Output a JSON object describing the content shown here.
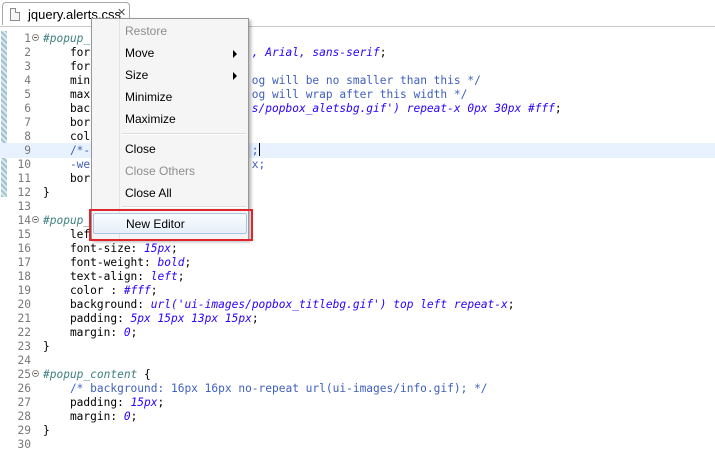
{
  "tab": {
    "filename": "jquery.alerts.css",
    "close_glyph": "✕"
  },
  "editor": {
    "current_line": 9,
    "lines": [
      {
        "n": "1",
        "fold": true,
        "parts": [
          [
            "c-sel",
            "#popup_"
          ]
        ]
      },
      {
        "n": "2",
        "fold": false,
        "parts": [
          [
            "c-prop",
            "    for"
          ],
          [
            "c-val",
            "                        , Arial, sans-serif"
          ],
          [
            "c-plain",
            ";"
          ]
        ]
      },
      {
        "n": "3",
        "fold": false,
        "parts": [
          [
            "c-prop",
            "    for"
          ]
        ]
      },
      {
        "n": "4",
        "fold": false,
        "parts": [
          [
            "c-prop",
            "    min"
          ],
          [
            "c-com",
            "                        og will be no smaller than this */"
          ]
        ]
      },
      {
        "n": "5",
        "fold": false,
        "parts": [
          [
            "c-prop",
            "    max"
          ],
          [
            "c-com",
            "                        og will wrap after this width */"
          ]
        ]
      },
      {
        "n": "6",
        "fold": false,
        "parts": [
          [
            "c-prop",
            "    bac"
          ],
          [
            "c-val",
            "                        s/popbox_aletsbg.gif') repeat-x 0px 30px #fff"
          ],
          [
            "c-plain",
            ";"
          ]
        ]
      },
      {
        "n": "7",
        "fold": false,
        "parts": [
          [
            "c-prop",
            "    bor"
          ]
        ]
      },
      {
        "n": "8",
        "fold": false,
        "parts": [
          [
            "c-prop",
            "    col"
          ]
        ]
      },
      {
        "n": "9",
        "fold": false,
        "parts": [
          [
            "c-com",
            "    /*-"
          ],
          [
            "c-com",
            "                        ;"
          ]
        ],
        "cursor": true
      },
      {
        "n": "10",
        "fold": false,
        "parts": [
          [
            "c-com",
            "    -we"
          ],
          [
            "c-com",
            "                        x;"
          ]
        ]
      },
      {
        "n": "11",
        "fold": false,
        "parts": [
          [
            "c-prop",
            "    bor"
          ]
        ]
      },
      {
        "n": "12",
        "fold": false,
        "parts": [
          [
            "c-plain",
            "}"
          ]
        ]
      },
      {
        "n": "13",
        "fold": false,
        "parts": []
      },
      {
        "n": "14",
        "fold": true,
        "parts": [
          [
            "c-sel",
            "#popup_"
          ]
        ]
      },
      {
        "n": "15",
        "fold": false,
        "parts": [
          [
            "c-prop",
            "    lef"
          ]
        ]
      },
      {
        "n": "16",
        "fold": false,
        "parts": [
          [
            "c-prop",
            "    font-size: "
          ],
          [
            "c-val",
            "15px"
          ],
          [
            "c-plain",
            ";"
          ]
        ]
      },
      {
        "n": "17",
        "fold": false,
        "parts": [
          [
            "c-prop",
            "    font-weight: "
          ],
          [
            "c-val",
            "bold"
          ],
          [
            "c-plain",
            ";"
          ]
        ]
      },
      {
        "n": "18",
        "fold": false,
        "parts": [
          [
            "c-prop",
            "    text-align: "
          ],
          [
            "c-val",
            "left"
          ],
          [
            "c-plain",
            ";"
          ]
        ]
      },
      {
        "n": "19",
        "fold": false,
        "parts": [
          [
            "c-prop",
            "    color : "
          ],
          [
            "c-val",
            "#fff"
          ],
          [
            "c-plain",
            ";"
          ]
        ]
      },
      {
        "n": "20",
        "fold": false,
        "parts": [
          [
            "c-prop",
            "    background: "
          ],
          [
            "c-val",
            "url('ui-images/popbox_titlebg.gif') top left repeat-x"
          ],
          [
            "c-plain",
            ";"
          ]
        ]
      },
      {
        "n": "21",
        "fold": false,
        "parts": [
          [
            "c-prop",
            "    padding: "
          ],
          [
            "c-val",
            "5px 15px 13px 15px"
          ],
          [
            "c-plain",
            ";"
          ]
        ]
      },
      {
        "n": "22",
        "fold": false,
        "parts": [
          [
            "c-prop",
            "    margin: "
          ],
          [
            "c-val",
            "0"
          ],
          [
            "c-plain",
            ";"
          ]
        ]
      },
      {
        "n": "23",
        "fold": false,
        "parts": [
          [
            "c-plain",
            "}"
          ]
        ]
      },
      {
        "n": "24",
        "fold": false,
        "parts": []
      },
      {
        "n": "25",
        "fold": true,
        "parts": [
          [
            "c-sel",
            "#popup_content"
          ],
          [
            "c-plain",
            " {"
          ]
        ]
      },
      {
        "n": "26",
        "fold": false,
        "parts": [
          [
            "c-com",
            "    /* background: 16px 16px no-repeat url(ui-images/info.gif); */"
          ]
        ]
      },
      {
        "n": "27",
        "fold": false,
        "parts": [
          [
            "c-prop",
            "    padding: "
          ],
          [
            "c-val",
            "15px"
          ],
          [
            "c-plain",
            ";"
          ]
        ]
      },
      {
        "n": "28",
        "fold": false,
        "parts": [
          [
            "c-prop",
            "    margin: "
          ],
          [
            "c-val",
            "0"
          ],
          [
            "c-plain",
            ";"
          ]
        ]
      },
      {
        "n": "29",
        "fold": false,
        "parts": [
          [
            "c-plain",
            "}"
          ]
        ]
      },
      {
        "n": "30",
        "fold": false,
        "parts": []
      }
    ]
  },
  "context_menu": {
    "items": [
      {
        "label": "Restore",
        "enabled": false,
        "submenu": false
      },
      {
        "label": "Move",
        "enabled": true,
        "submenu": true
      },
      {
        "label": "Size",
        "enabled": true,
        "submenu": true
      },
      {
        "label": "Minimize",
        "enabled": true,
        "submenu": false
      },
      {
        "label": "Maximize",
        "enabled": true,
        "submenu": false
      },
      {
        "label": "Close",
        "enabled": true,
        "submenu": false
      },
      {
        "label": "Close Others",
        "enabled": false,
        "submenu": false
      },
      {
        "label": "Close All",
        "enabled": true,
        "submenu": false
      },
      {
        "label": "New Editor",
        "enabled": true,
        "submenu": false,
        "highlighted": true
      }
    ]
  },
  "colors": {
    "highlight_border": "#e0262d",
    "selector": "#3f7f7f",
    "value": "#2a00ff",
    "comment": "#3f5fbf"
  }
}
